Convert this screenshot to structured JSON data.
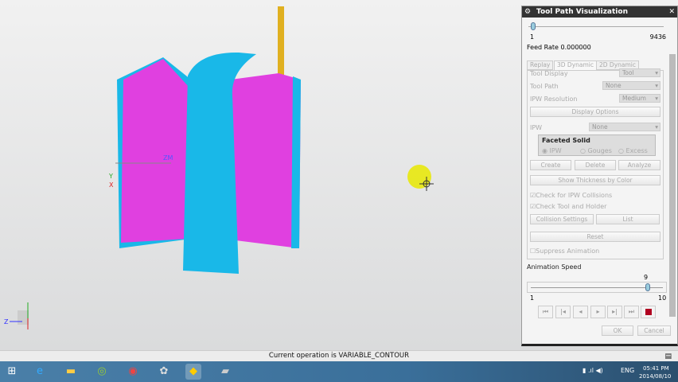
{
  "panel": {
    "title": "Tool Path Visualization",
    "slider_min": "1",
    "slider_max": "9436",
    "slider_value_fraction": 0.0,
    "feed_rate": "Feed Rate 0.000000",
    "tabs": [
      "Replay",
      "3D Dynamic",
      "2D Dynamic"
    ],
    "active_tab": "3D Dynamic",
    "tool_display_label": "Tool Display",
    "tool_display_value": "Tool",
    "tool_path_label": "Tool Path",
    "tool_path_value": "None",
    "ipw_resolution_label": "IPW Resolution",
    "ipw_resolution_value": "Medium",
    "display_options": "Display Options",
    "ipw_label": "IPW",
    "ipw_value": "None",
    "faceted_solid": "Faceted Solid",
    "radios": [
      "IPW",
      "Gouges",
      "Excess"
    ],
    "create": "Create",
    "delete": "Delete",
    "analyze": "Analyze",
    "show_thickness": "Show Thickness by Color",
    "check_ipw_collisions": "Check for IPW Collisions",
    "check_tool_holder": "Check Tool and Holder",
    "collision_settings": "Collision Settings",
    "list": "List",
    "reset": "Reset",
    "suppress_animation": "Suppress Animation",
    "animation_speed_label": "Animation Speed",
    "speed_value": "9",
    "speed_min": "1",
    "speed_max": "10",
    "ok": "OK",
    "cancel": "Cancel",
    "stop_color": "#b00020"
  },
  "viewport": {
    "axis_labels": {
      "z": "Z",
      "y": "Y",
      "x": "X",
      "zm": "ZM"
    }
  },
  "status": "Current operation is VARIABLE_CONTOUR",
  "tray": {
    "lang": "ENG",
    "time": "05:41 PM",
    "date": "2014/08/10"
  },
  "colors": {
    "magenta": "#e040e0",
    "cyan": "#19b8e8",
    "tool": "#e0b020"
  }
}
